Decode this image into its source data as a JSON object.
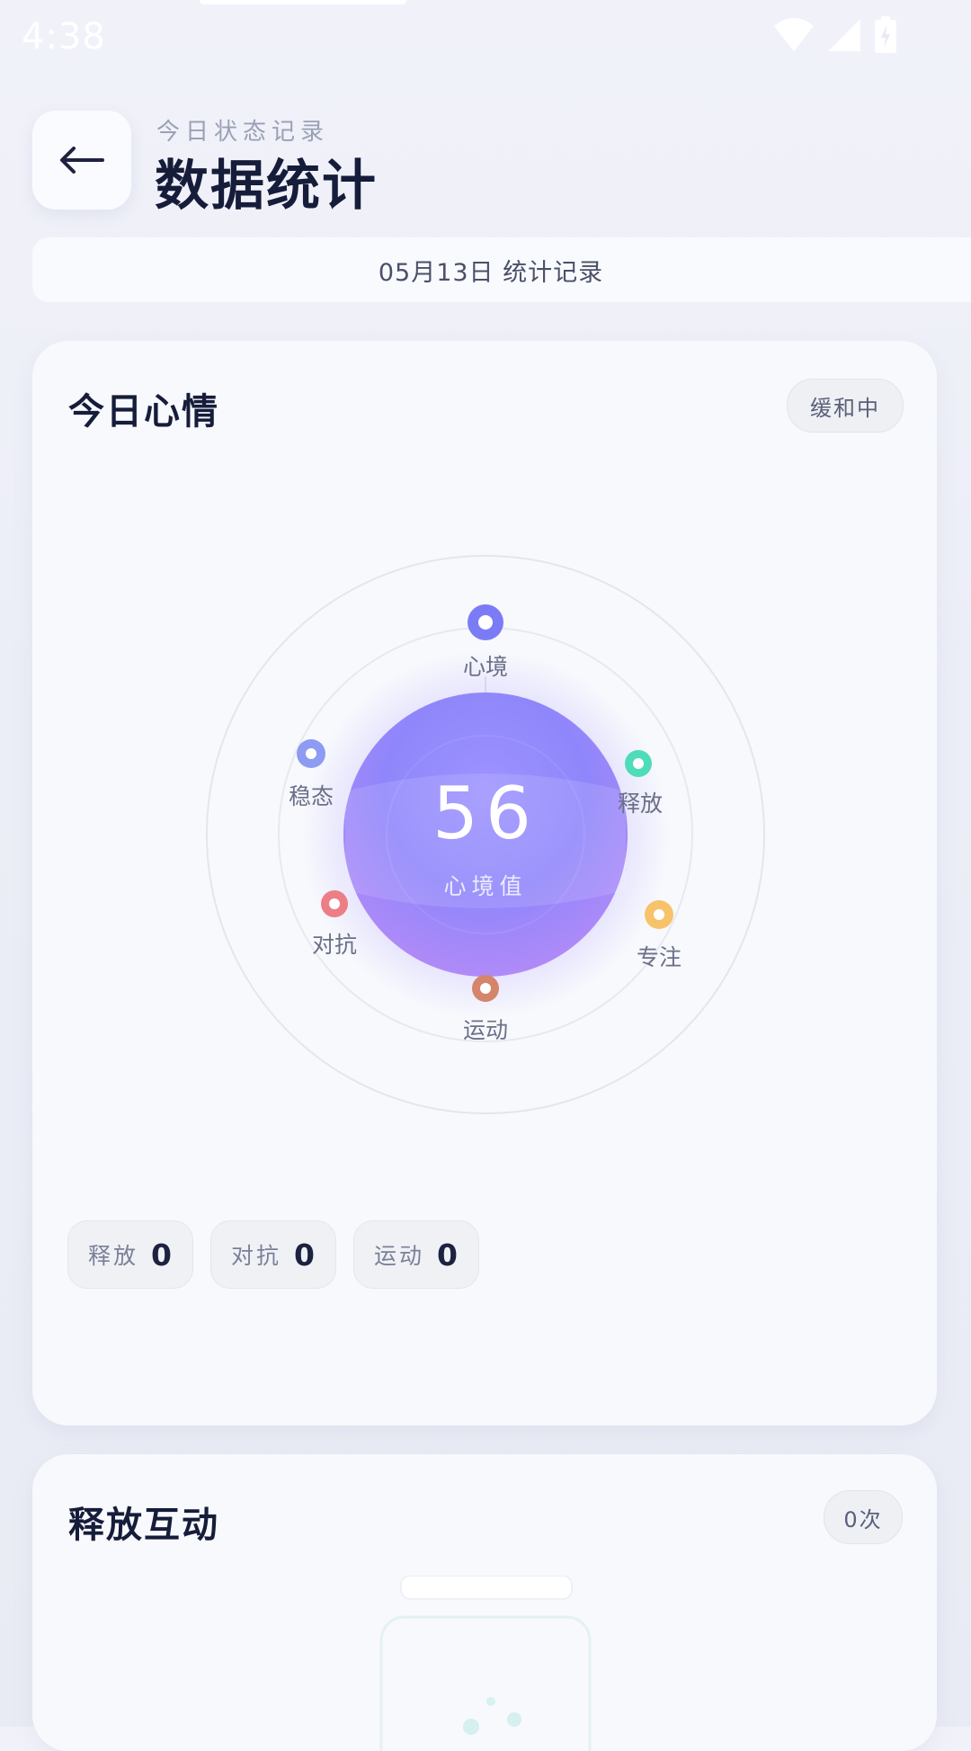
{
  "status_bar": {
    "time": "4:38"
  },
  "header": {
    "subtitle": "今日状态记录",
    "title": "数据统计"
  },
  "date_bar": {
    "text": "05月13日 统计记录"
  },
  "mood_card": {
    "title": "今日心情",
    "status_pill": "缓和中",
    "score": "56",
    "score_label": "心境值",
    "nodes": [
      {
        "label": "心境",
        "color": "#7b7cf5"
      },
      {
        "label": "释放",
        "color": "#4fdcb8"
      },
      {
        "label": "专注",
        "color": "#f7c36a"
      },
      {
        "label": "运动",
        "color": "#d4856a"
      },
      {
        "label": "对抗",
        "color": "#ec7f86"
      },
      {
        "label": "稳态",
        "color": "#8e9bf2"
      }
    ],
    "stats": [
      {
        "label": "释放",
        "value": "0"
      },
      {
        "label": "对抗",
        "value": "0"
      },
      {
        "label": "运动",
        "value": "0"
      }
    ]
  },
  "release_card": {
    "title": "释放互动",
    "count_pill": "0次"
  },
  "colors": {
    "accent": "#8b7cf7",
    "title": "#161d3a"
  }
}
